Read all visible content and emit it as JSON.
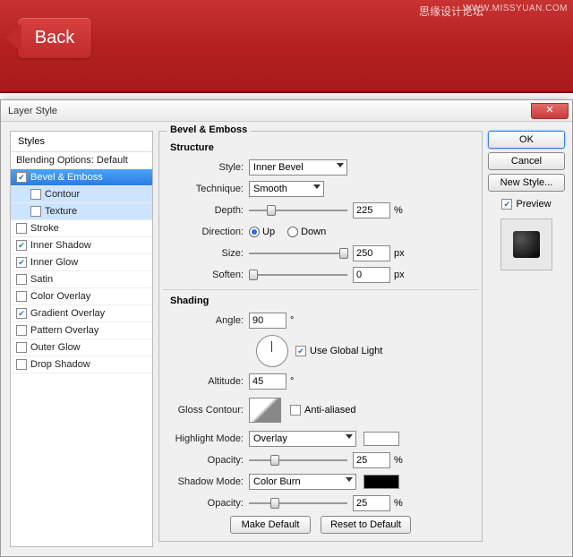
{
  "banner": {
    "back": "Back",
    "wm1": "思缘设计论坛",
    "wm2": "WWW.MISSYUAN.COM"
  },
  "dialog": {
    "title": "Layer Style",
    "styles_header": "Styles",
    "blending": "Blending Options: Default",
    "items": [
      {
        "label": "Bevel & Emboss",
        "on": true,
        "sel": true
      },
      {
        "label": "Contour",
        "on": false,
        "sub": true,
        "sel": false
      },
      {
        "label": "Texture",
        "on": false,
        "sub": true,
        "sel": false
      },
      {
        "label": "Stroke",
        "on": false
      },
      {
        "label": "Inner Shadow",
        "on": true
      },
      {
        "label": "Inner Glow",
        "on": true
      },
      {
        "label": "Satin",
        "on": false
      },
      {
        "label": "Color Overlay",
        "on": false
      },
      {
        "label": "Gradient Overlay",
        "on": true
      },
      {
        "label": "Pattern Overlay",
        "on": false
      },
      {
        "label": "Outer Glow",
        "on": false
      },
      {
        "label": "Drop Shadow",
        "on": false
      }
    ]
  },
  "bevel": {
    "group": "Bevel & Emboss",
    "structure": "Structure",
    "style_lbl": "Style:",
    "style_val": "Inner Bevel",
    "tech_lbl": "Technique:",
    "tech_val": "Smooth",
    "depth_lbl": "Depth:",
    "depth_val": "225",
    "pct": "%",
    "dir_lbl": "Direction:",
    "up": "Up",
    "down": "Down",
    "size_lbl": "Size:",
    "size_val": "250",
    "px": "px",
    "soften_lbl": "Soften:",
    "soften_val": "0",
    "shading": "Shading",
    "angle_lbl": "Angle:",
    "angle_val": "90",
    "deg": "°",
    "global": "Use Global Light",
    "alt_lbl": "Altitude:",
    "alt_val": "45",
    "gloss_lbl": "Gloss Contour:",
    "aa": "Anti-aliased",
    "hmode_lbl": "Highlight Mode:",
    "hmode_val": "Overlay",
    "hcolor": "#ffffff",
    "hopac_lbl": "Opacity:",
    "hopac_val": "25",
    "smode_lbl": "Shadow Mode:",
    "smode_val": "Color Burn",
    "scolor": "#000000",
    "sopac_lbl": "Opacity:",
    "sopac_val": "25",
    "make_default": "Make Default",
    "reset_default": "Reset to Default"
  },
  "side": {
    "ok": "OK",
    "cancel": "Cancel",
    "newstyle": "New Style...",
    "preview": "Preview"
  }
}
